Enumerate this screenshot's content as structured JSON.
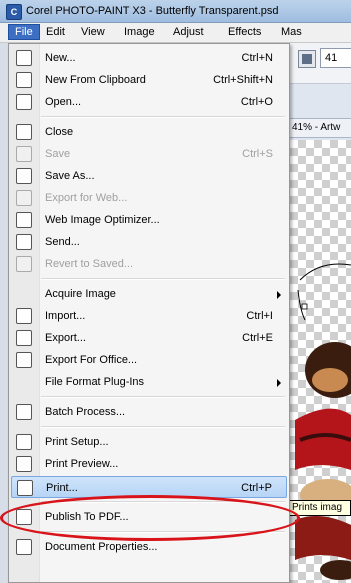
{
  "window": {
    "title": "Corel PHOTO-PAINT X3 - Butterfly Transparent.psd",
    "app_icon_text": "C"
  },
  "menubar": [
    {
      "label": "File"
    },
    {
      "label": "Edit"
    },
    {
      "label": "View"
    },
    {
      "label": "Image"
    },
    {
      "label": "Adjust"
    },
    {
      "label": "Effects"
    },
    {
      "label": "Mas"
    }
  ],
  "toolbar": {
    "zoom_value": "41"
  },
  "document_tab": {
    "label": "41% - Artw"
  },
  "tooltip": {
    "text": "Prints imag"
  },
  "file_menu": {
    "items": [
      {
        "label": "New...",
        "shortcut": "Ctrl+N",
        "icon": "new-document-icon"
      },
      {
        "label": "New From Clipboard",
        "shortcut": "Ctrl+Shift+N",
        "icon": "clipboard-icon"
      },
      {
        "label": "Open...",
        "shortcut": "Ctrl+O",
        "icon": "open-folder-icon"
      },
      {
        "label": "Close",
        "shortcut": "",
        "icon": "close-document-icon"
      },
      {
        "label": "Save",
        "shortcut": "Ctrl+S",
        "icon": "save-icon",
        "disabled": true
      },
      {
        "label": "Save As...",
        "shortcut": "",
        "icon": "save-as-icon"
      },
      {
        "label": "Export for Web...",
        "shortcut": "",
        "icon": "export-web-icon",
        "disabled": true
      },
      {
        "label": "Web Image Optimizer...",
        "shortcut": "",
        "icon": "web-optimizer-icon"
      },
      {
        "label": "Send...",
        "shortcut": "",
        "icon": "send-icon"
      },
      {
        "label": "Revert to Saved...",
        "shortcut": "",
        "icon": "revert-icon",
        "disabled": true
      },
      {
        "label": "Acquire Image",
        "shortcut": "",
        "submenu": true
      },
      {
        "label": "Import...",
        "shortcut": "Ctrl+I",
        "icon": "import-icon"
      },
      {
        "label": "Export...",
        "shortcut": "Ctrl+E",
        "icon": "export-icon"
      },
      {
        "label": "Export For Office...",
        "shortcut": "",
        "icon": "export-office-icon"
      },
      {
        "label": "File Format Plug-Ins",
        "shortcut": "",
        "submenu": true
      },
      {
        "label": "Batch Process...",
        "shortcut": "",
        "icon": "batch-process-icon"
      },
      {
        "label": "Print Setup...",
        "shortcut": "",
        "icon": "print-setup-icon"
      },
      {
        "label": "Print Preview...",
        "shortcut": "",
        "icon": "print-preview-icon"
      },
      {
        "label": "Print...",
        "shortcut": "Ctrl+P",
        "icon": "printer-icon",
        "highlighted": true
      },
      {
        "label": "Publish To PDF...",
        "shortcut": "",
        "icon": "pdf-icon"
      },
      {
        "label": "Document Properties...",
        "shortcut": "",
        "icon": "info-icon"
      }
    ]
  },
  "colors": {
    "highlight": "#b6d4f6",
    "annotation": "#d8141a",
    "menubar_active": "#3c6fc4"
  }
}
